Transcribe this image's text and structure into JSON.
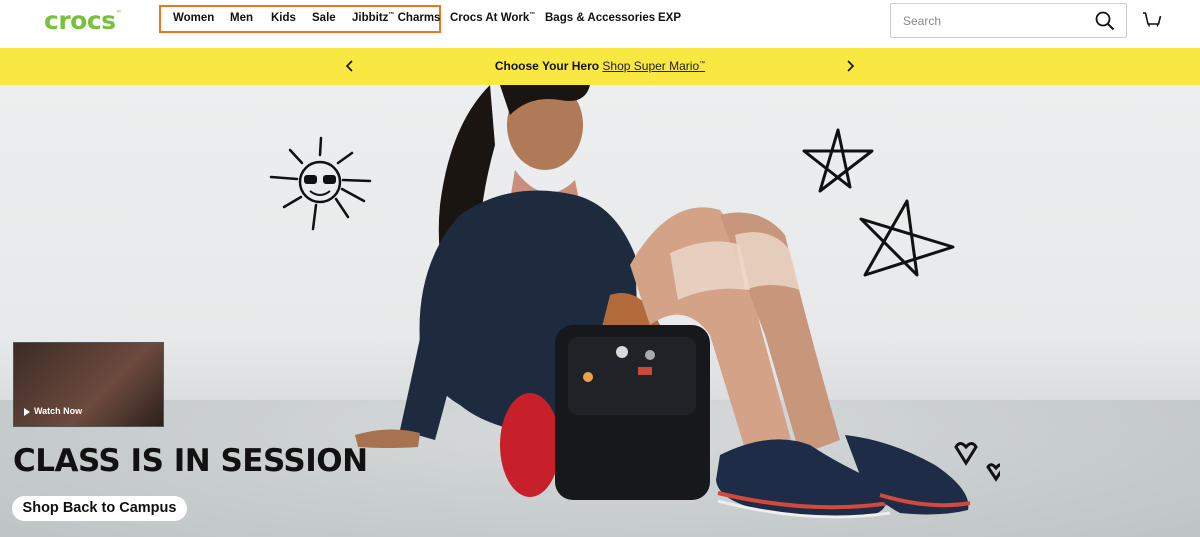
{
  "header": {
    "logo_text": "crocs",
    "logo_tm": "™",
    "nav": [
      {
        "label": "Women"
      },
      {
        "label": "Men"
      },
      {
        "label": "Kids"
      },
      {
        "label": "Sale"
      },
      {
        "label": "Jibbitz",
        "tm": "™",
        "label2": " Charms"
      },
      {
        "label": "Crocs At Work",
        "tm": "™"
      },
      {
        "label": "Bags & Accessories"
      },
      {
        "label": "EXP"
      }
    ],
    "search_placeholder": "Search"
  },
  "promo": {
    "lead": "Choose Your Hero",
    "link": "Shop Super Mario",
    "link_tm": "™"
  },
  "hero": {
    "thumb_label": "Watch Now",
    "headline": "CLASS IS IN SESSION",
    "cta": "Shop Back to Campus"
  },
  "colors": {
    "brand_green": "#78c13c",
    "promo_yellow": "#fae842",
    "highlight_orange": "#e87722"
  }
}
